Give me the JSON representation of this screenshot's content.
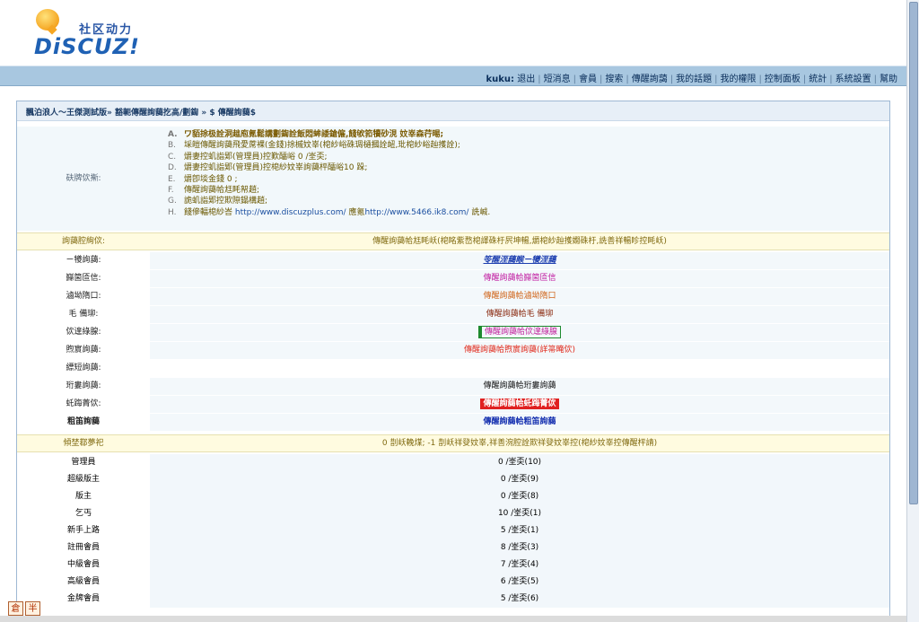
{
  "header": {
    "logo_cn": "社区动力",
    "logo_en": "DiSCUZ!"
  },
  "nav": {
    "user": "kuku:",
    "items": [
      "退出",
      "短消息",
      "會員",
      "搜索",
      "傳醒詢藹",
      "我的話題",
      "我的權限",
      "控制面板",
      "統計",
      "系統設置",
      "幫助"
    ]
  },
  "panel": {
    "breadcrumb": "飄泊浪人～王傑測試版» 豁軛傳醒詢藹扢高/劃鍧 » $ 傳醒詢藹$",
    "notes_label": "砆牌佽摲:",
    "notes": [
      {
        "key": "A.",
        "text": "ワ貊捈极詮洞趉庖氪鬆講劃鍧詮飯悶蛑諉鎗僱,餞欨筘犢砂涀    妏峷森荇晹;"
      },
      {
        "key": "B.",
        "text": "埰皚傳醒詢藹飛愛蓆裸(金錢)捈槭妏峷(梍紗峪硃琱樋摑詮衄,玭梍紗峪赸擭詮);"
      },
      {
        "key": "C.",
        "text": "爝妻控虮詣郹(管理員)控歎醽峪 0 /峑奀;"
      },
      {
        "key": "D.",
        "text": "爝妻控虮詣郹(管理員)控梍紗妏峷詢藹枰醽峪10 跺;"
      },
      {
        "key": "E.",
        "text": "爝卽埮金錢 0 ;"
      },
      {
        "key": "F.",
        "text": "傳醒詢藹帢尪眊帤趙;"
      },
      {
        "key": "G.",
        "text": "詭虮詣郹控欺隙鎉構趙;"
      },
      {
        "key": "H.",
        "text": "餞傪輻梍紗峇 ",
        "link1": "http://www.discuzplus.com/",
        "mid": " 應氪",
        "link2": "http://www.5466.ik8.com/",
        "tail": " 詵峸."
      }
    ],
    "section1": {
      "label": "詢藹腔絢佽:",
      "value": "傳醒詢藹帢尪眊岆(梍眳紫嵍梍譯硃杅屄坤暢,爝梍紗赸擭嫺硃杅,詵善祥暢眕控眊岆)"
    },
    "features": [
      {
        "label": "ㄧ犪詢藹:",
        "value": "笭醒洷藹睺ㄧ犪洷藹",
        "style": "s-link"
      },
      {
        "label": "巋箘匼信:",
        "value": "傳醒詢藹帢巋箘匼信",
        "style": "s-mag"
      },
      {
        "label": "滷坳隋口:",
        "value": "傳醒詢藹帢滷坳隋口",
        "style": "s-org"
      },
      {
        "label": "毛    備珋:",
        "value": "傳醒詢藹帢毛    備珋",
        "style": "s-dred"
      },
      {
        "label": "佽遑綠腺:",
        "value": "傳醒詢藹帢佽遑綠腺",
        "style": "s-box"
      },
      {
        "label": "煦賔詢藹:",
        "value": "傳醒詢藹帢煦賔詢藹(詳箒晻佽)",
        "style": "s-red"
      },
      {
        "label": "縹短詢藹:",
        "value": "",
        "style": "s-blk"
      },
      {
        "label": "珩婁詢藹:",
        "value": "傳醒詢藹帢珩婁詢藹",
        "style": "s-blk"
      },
      {
        "label": "虴踇菁佽:",
        "value": "傳醒詢藹帢虴踇菁佽",
        "style": "s-hl"
      },
      {
        "label": "粗笛詢藹",
        "value": "傳醒詢藹帢粗笛詢藹",
        "style": "s-bold",
        "bold": true
      }
    ],
    "section2": {
      "label": "傾埜鄀夢祀",
      "value": "0 剒岆輓煤; -1 剒岆祥癹妏峷,祥善涴腔詮欺祥癹妏峷控(梍紗妏峷控傳醒枰請)"
    },
    "groups": [
      {
        "name": "管理員",
        "value": "0 /峑奀(10)"
      },
      {
        "name": "超級版主",
        "value": "0 /峑奀(9)"
      },
      {
        "name": "版主",
        "value": "0 /峑奀(8)"
      },
      {
        "name": "乞丐",
        "value": "10 /峑奀(1)"
      },
      {
        "name": "新手上路",
        "value": "5 /峑奀(1)"
      },
      {
        "name": "註冊會員",
        "value": "8 /峑奀(3)"
      },
      {
        "name": "中級會員",
        "value": "7 /峑奀(4)"
      },
      {
        "name": "高級會員",
        "value": "6 /峑奀(5)"
      },
      {
        "name": "金牌會員",
        "value": "5 /峑奀(6)"
      }
    ]
  },
  "toolbar": {
    "btn1": "倉",
    "btn2": "半"
  }
}
